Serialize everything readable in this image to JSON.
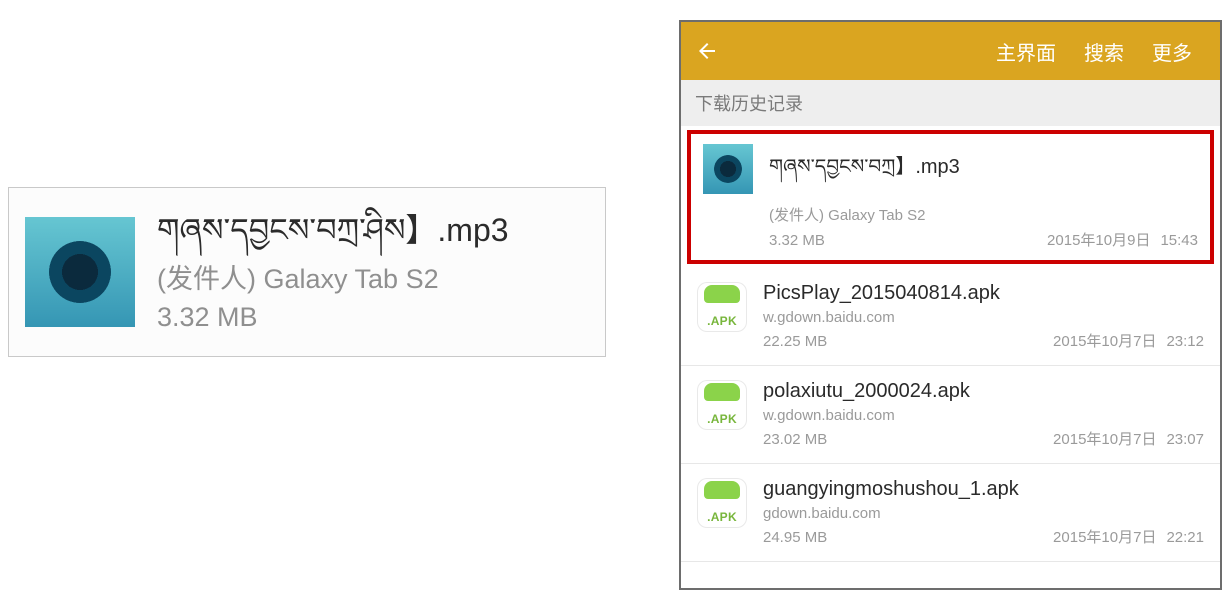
{
  "zoom": {
    "title": "གཞས་དབྱངས་བཀྲ་ཤིས】.mp3",
    "sender": "(发件人) Galaxy Tab S2",
    "size": "3.32 MB"
  },
  "appbar": {
    "home": "主界面",
    "search": "搜索",
    "more": "更多"
  },
  "section_header": "下载历史记录",
  "downloads": [
    {
      "type": "music",
      "highlight": true,
      "title": "གཞས་དབྱངས་བཀྲ】.mp3",
      "subtitle": "(发件人) Galaxy Tab S2",
      "size": "3.32 MB",
      "date": "2015年10月9日",
      "time": "15:43"
    },
    {
      "type": "apk",
      "highlight": false,
      "title": "PicsPlay_2015040814.apk",
      "subtitle": "w.gdown.baidu.com",
      "size": "22.25 MB",
      "date": "2015年10月7日",
      "time": "23:12"
    },
    {
      "type": "apk",
      "highlight": false,
      "title": "polaxiutu_2000024.apk",
      "subtitle": "w.gdown.baidu.com",
      "size": "23.02 MB",
      "date": "2015年10月7日",
      "time": "23:07"
    },
    {
      "type": "apk",
      "highlight": false,
      "title": "guangyingmoshushou_1.apk",
      "subtitle": "gdown.baidu.com",
      "size": "24.95 MB",
      "date": "2015年10月7日",
      "time": "22:21"
    }
  ],
  "apk_badge_label": ".APK"
}
